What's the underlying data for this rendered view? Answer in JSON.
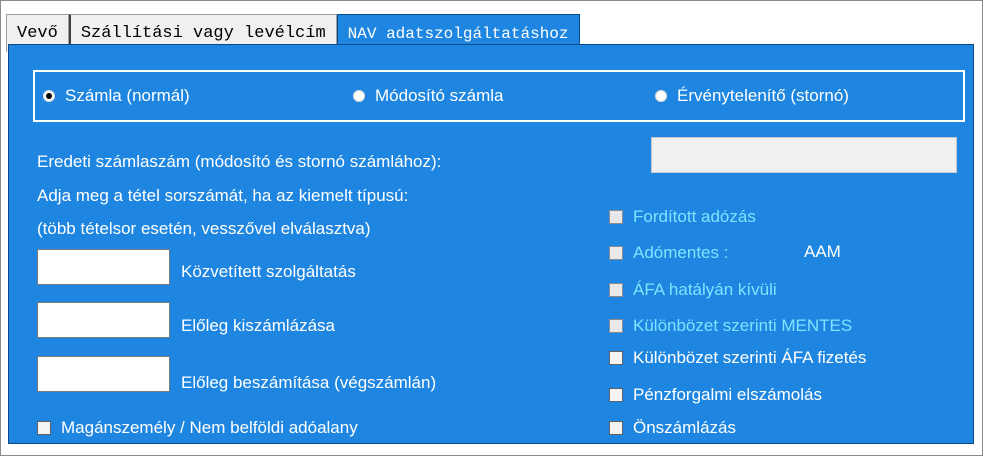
{
  "tabs": [
    {
      "label": "Vevő"
    },
    {
      "label": "Szállítási vagy levélcím"
    },
    {
      "label": "NAV adatszolgáltatáshoz"
    }
  ],
  "invoice_type": {
    "options": [
      "Számla (normál)",
      "Módosító számla",
      "Érvénytelenítő (stornó)"
    ],
    "selected": "Számla (normál)"
  },
  "original_invoice": {
    "label": "Eredeti számlaszám (módosító és stornó számlához):",
    "value": ""
  },
  "item_instructions": {
    "line1": "Adja meg a tétel sorszámát, ha az kiemelt típusú:",
    "line2": "(több tételsor esetén, vesszővel elválasztva)"
  },
  "item_fields": [
    {
      "label": "Közvetített szolgáltatás",
      "value": ""
    },
    {
      "label": "Előleg kiszámlázása",
      "value": ""
    },
    {
      "label": "Előleg beszámítása (végszámlán)",
      "value": ""
    }
  ],
  "private_person": {
    "label": "Magánszemély / Nem belföldi adóalany",
    "checked": false
  },
  "tax_flags": [
    {
      "label": "Fordított adózás",
      "checked": false,
      "enabled": false
    },
    {
      "label": "Adómentes :",
      "checked": false,
      "enabled": false,
      "suffix": "AAM"
    },
    {
      "label": "ÁFA hatályán kívüli",
      "checked": false,
      "enabled": false
    },
    {
      "label": "Különbözet szerinti MENTES",
      "checked": false,
      "enabled": false
    },
    {
      "label": "Különbözet szerinti ÁFA fizetés",
      "checked": false,
      "enabled": true
    },
    {
      "label": "Pénzforgalmi elszámolás",
      "checked": false,
      "enabled": true
    },
    {
      "label": "Önszámlázás",
      "checked": false,
      "enabled": true
    }
  ],
  "colors": {
    "panel": "#1e86e0",
    "disabled_text": "#7fe3ff",
    "text": "#ffffff"
  }
}
